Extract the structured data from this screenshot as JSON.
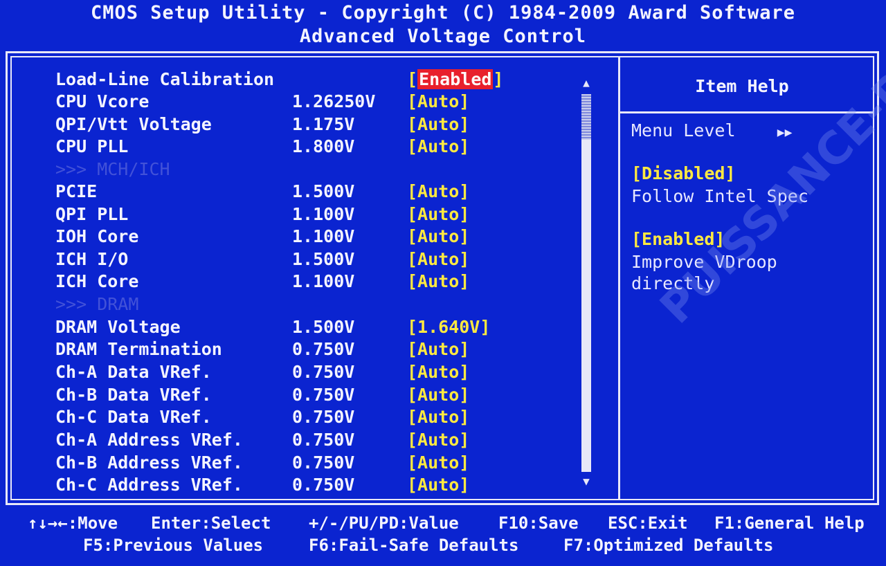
{
  "header": {
    "line1": "CMOS Setup Utility - Copyright (C) 1984-2009 Award Software",
    "line2": "Advanced Voltage Control"
  },
  "settings": [
    {
      "label": "Load-Line Calibration",
      "value": "",
      "setting": "[Enabled]"
    },
    {
      "label": "CPU Vcore",
      "value": "1.26250V",
      "setting": "[Auto]"
    },
    {
      "label": "QPI/Vtt Voltage",
      "value": "1.175V",
      "setting": "[Auto]"
    },
    {
      "label": "CPU PLL",
      "value": "1.800V",
      "setting": "[Auto]"
    },
    {
      "label": ">>> MCH/ICH",
      "value": "",
      "setting": ""
    },
    {
      "label": "PCIE",
      "value": "1.500V",
      "setting": "[Auto]"
    },
    {
      "label": "QPI PLL",
      "value": "1.100V",
      "setting": "[Auto]"
    },
    {
      "label": "IOH Core",
      "value": "1.100V",
      "setting": "[Auto]"
    },
    {
      "label": "ICH I/O",
      "value": "1.500V",
      "setting": "[Auto]"
    },
    {
      "label": "ICH Core",
      "value": "1.100V",
      "setting": "[Auto]"
    },
    {
      "label": ">>> DRAM",
      "value": "",
      "setting": ""
    },
    {
      "label": "DRAM Voltage",
      "value": "1.500V",
      "setting": "[1.640V]"
    },
    {
      "label": "DRAM Termination",
      "value": "0.750V",
      "setting": "[Auto]"
    },
    {
      "label": "Ch-A Data VRef.",
      "value": "0.750V",
      "setting": "[Auto]"
    },
    {
      "label": "Ch-B Data VRef.",
      "value": "0.750V",
      "setting": "[Auto]"
    },
    {
      "label": "Ch-C Data VRef.",
      "value": "0.750V",
      "setting": "[Auto]"
    },
    {
      "label": "Ch-A Address VRef.",
      "value": "0.750V",
      "setting": "[Auto]"
    },
    {
      "label": "Ch-B Address VRef.",
      "value": "0.750V",
      "setting": "[Auto]"
    },
    {
      "label": "Ch-C Address VRef.",
      "value": "0.750V",
      "setting": "[Auto]"
    }
  ],
  "selected": {
    "bracket_open": "[",
    "text": "Enabled",
    "bracket_close": "]"
  },
  "scrollbar": {
    "up_icon": "▲",
    "down_icon": "▼"
  },
  "help": {
    "title": "Item Help",
    "menu_level": "Menu Level",
    "menu_level_icon": "▶▶",
    "lines": [
      {
        "text": "[Disabled]",
        "yellow": true
      },
      {
        "text": "Follow Intel Spec",
        "yellow": false
      },
      {
        "text": "[Enabled]",
        "yellow": true
      },
      {
        "text": "Improve VDroop",
        "yellow": false
      },
      {
        "text": "directly",
        "yellow": false
      }
    ]
  },
  "watermark": "PUISSANCE-PC",
  "footer": {
    "row1": [
      "↑↓→←:Move",
      "Enter:Select",
      "+/-/PU/PD:Value",
      "F10:Save",
      "ESC:Exit",
      "F1:General Help"
    ],
    "row2": [
      "F5:Previous Values",
      "F6:Fail-Safe Defaults",
      "F7:Optimized Defaults"
    ]
  }
}
